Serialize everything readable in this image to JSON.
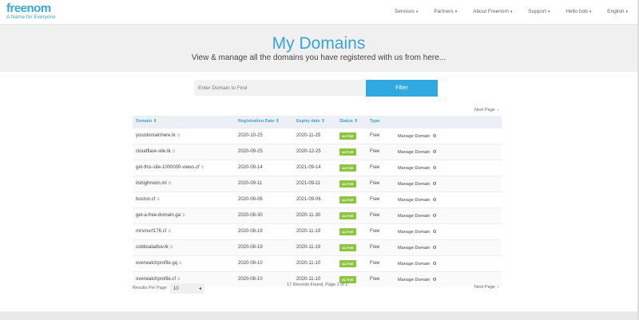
{
  "header": {
    "brand": "freenom",
    "tagline": "A Name for Everyone",
    "nav": [
      {
        "label": "Services",
        "caret": "▾"
      },
      {
        "label": "Partners",
        "caret": "▾"
      },
      {
        "label": "About Freenom",
        "caret": "▾"
      },
      {
        "label": "Support",
        "caret": "▾"
      },
      {
        "label": "Hello bob",
        "caret": "▾"
      },
      {
        "label": "English",
        "caret": "▾"
      }
    ]
  },
  "hero": {
    "title": "My Domains",
    "subtitle": "View & manage all the domains you have registered with us from here..."
  },
  "search": {
    "placeholder": "Enter Domain to Find",
    "button": "Filter"
  },
  "pagination": {
    "next_label": "Next Page",
    "arrow": "›",
    "summary": "17 Records Found, Page 1 of 2",
    "results_per_page_label": "Results Per Page",
    "results_per_page_value": "10",
    "select_arrow": "◂"
  },
  "table": {
    "columns": {
      "domain": "Domain",
      "registration": "Registration Date",
      "expiry": "Expiry date",
      "status": "Status",
      "type": "Type"
    },
    "sort_icon": "⇕",
    "ext_icon": "⧉",
    "manage_label": "Manage Domain",
    "gear_icon": "⚙",
    "rows": [
      {
        "domain": "yourdomainhere.tk",
        "registration": "2020-10-25",
        "expiry": "2020-11-25",
        "status": "ACTIVE",
        "type": "Free"
      },
      {
        "domain": "cloudflare-site.tk",
        "registration": "2020-09-25",
        "expiry": "2020-12-25",
        "status": "ACTIVE",
        "type": "Free"
      },
      {
        "domain": "get-this-site-1000000-views.cf",
        "registration": "2020-09-14",
        "expiry": "2021-09-14",
        "status": "ACTIVE",
        "type": "Free"
      },
      {
        "domain": "itshighnoon.ml",
        "registration": "2020-09-11",
        "expiry": "2021-09-11",
        "status": "ACTIVE",
        "type": "Free"
      },
      {
        "domain": "boston.cf",
        "registration": "2020-09-06",
        "expiry": "2021-09-06",
        "status": "ACTIVE",
        "type": "Free"
      },
      {
        "domain": "get-a-free-domain.ga",
        "registration": "2020-08-30",
        "expiry": "2020-11-30",
        "status": "ACTIVE",
        "type": "Free"
      },
      {
        "domain": "mrsmurf176.cf",
        "registration": "2020-08-19",
        "expiry": "2020-11-19",
        "status": "ACTIVE",
        "type": "Free"
      },
      {
        "domain": "cobbsaladluv.tk",
        "registration": "2020-08-19",
        "expiry": "2020-11-19",
        "status": "ACTIVE",
        "type": "Free"
      },
      {
        "domain": "overwatchprofile.gq",
        "registration": "2020-08-10",
        "expiry": "2020-11-10",
        "status": "ACTIVE",
        "type": "Free"
      },
      {
        "domain": "overwatchprofile.cf",
        "registration": "2020-08-10",
        "expiry": "2020-11-10",
        "status": "ACTIVE",
        "type": "Free"
      }
    ]
  }
}
